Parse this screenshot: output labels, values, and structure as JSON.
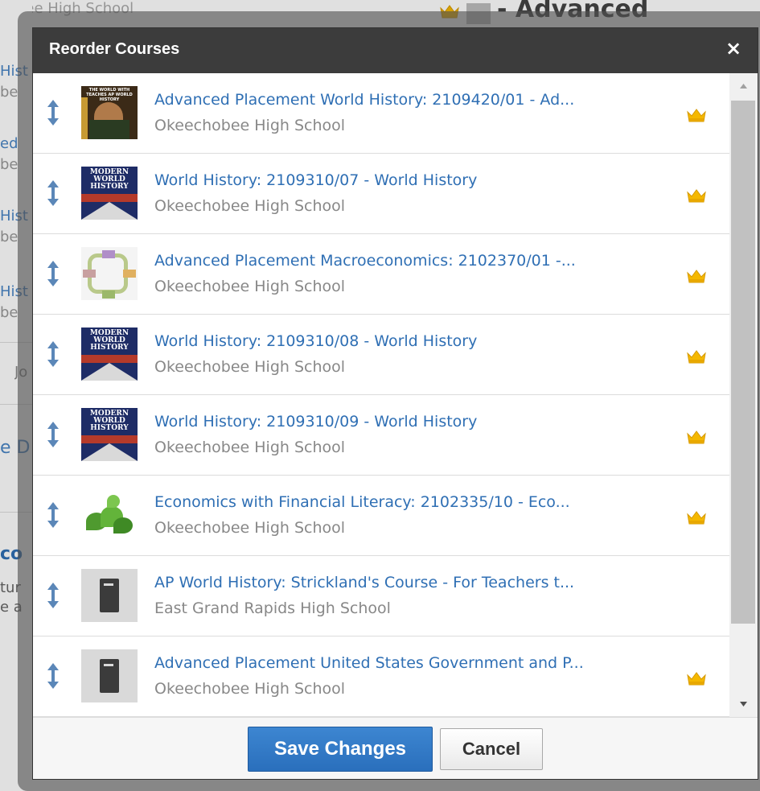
{
  "background": {
    "school_partial": "bee High School",
    "header_partial": "- Advanced",
    "side_fragments": [
      "Hist",
      "be",
      "ed",
      "be",
      "Hist",
      "be",
      "Hist",
      "be",
      "Jo",
      "e D",
      "co",
      "tur",
      "e a"
    ]
  },
  "modal": {
    "title": "Reorder Courses",
    "close_glyph": "×",
    "save_label": "Save Changes",
    "cancel_label": "Cancel",
    "courses": [
      {
        "title": "Advanced Placement World History: 2109420/01 - Ad...",
        "school": "Okeechobee High School",
        "thumb": "ap-book",
        "crown": true,
        "thumb_header": "THE WORLD WITH TEACHES AP WORLD HISTORY"
      },
      {
        "title": "World History: 2109310/07 - World History",
        "school": "Okeechobee High School",
        "thumb": "modern-world-history",
        "crown": true
      },
      {
        "title": "Advanced Placement Macroeconomics: 2102370/01 -...",
        "school": "Okeechobee High School",
        "thumb": "econ-cycle",
        "crown": true
      },
      {
        "title": "World History: 2109310/08 - World History",
        "school": "Okeechobee High School",
        "thumb": "modern-world-history",
        "crown": true
      },
      {
        "title": "World History: 2109310/09 - World History",
        "school": "Okeechobee High School",
        "thumb": "modern-world-history",
        "crown": true
      },
      {
        "title": "Economics with Financial Literacy: 2102335/10 - Eco...",
        "school": "Okeechobee High School",
        "thumb": "green-dollar",
        "crown": true
      },
      {
        "title": "AP World History: Strickland's Course - For Teachers t...",
        "school": "East Grand Rapids High School",
        "thumb": "gray-book",
        "crown": false
      },
      {
        "title": "Advanced Placement United States Government and P...",
        "school": "Okeechobee High School",
        "thumb": "gray-book",
        "crown": true
      }
    ],
    "book_cover_text": [
      "MODERN",
      "WORLD",
      "HISTORY"
    ],
    "icons": {
      "drag": "up-down-arrow-icon",
      "crown": "crown-icon",
      "close": "close-icon",
      "scroll_up": "scroll-up-arrow-icon",
      "scroll_down": "scroll-down-arrow-icon"
    },
    "colors": {
      "link": "#2f6fb4",
      "crown": "#f5b800",
      "titlebar": "#3c3c3c",
      "save_button": "#2f78c4"
    }
  }
}
